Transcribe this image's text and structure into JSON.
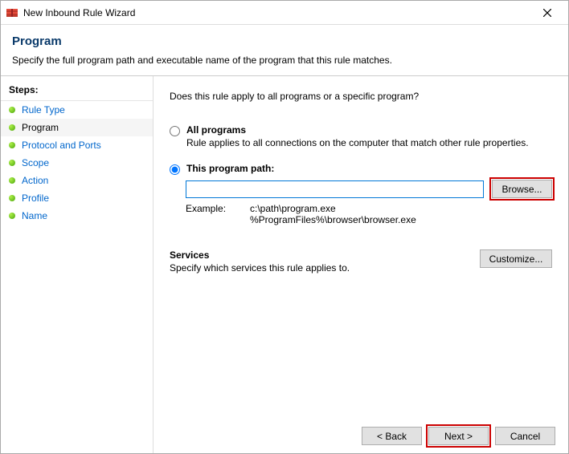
{
  "window": {
    "title": "New Inbound Rule Wizard"
  },
  "header": {
    "title": "Program",
    "subtitle": "Specify the full program path and executable name of the program that this rule matches."
  },
  "steps": {
    "title": "Steps:",
    "items": [
      {
        "label": "Rule Type",
        "current": false
      },
      {
        "label": "Program",
        "current": true
      },
      {
        "label": "Protocol and Ports",
        "current": false
      },
      {
        "label": "Scope",
        "current": false
      },
      {
        "label": "Action",
        "current": false
      },
      {
        "label": "Profile",
        "current": false
      },
      {
        "label": "Name",
        "current": false
      }
    ]
  },
  "content": {
    "question": "Does this rule apply to all programs or a specific program?",
    "options": {
      "all": {
        "label": "All programs",
        "desc": "Rule applies to all connections on the computer that match other rule properties.",
        "selected": false
      },
      "path": {
        "label": "This program path:",
        "selected": true,
        "value": "",
        "browse": "Browse...",
        "example_label": "Example:",
        "example_text": "c:\\path\\program.exe\n%ProgramFiles%\\browser\\browser.exe"
      }
    },
    "services": {
      "title": "Services",
      "desc": "Specify which services this rule applies to.",
      "customize": "Customize..."
    }
  },
  "footer": {
    "back": "< Back",
    "next": "Next >",
    "cancel": "Cancel"
  }
}
